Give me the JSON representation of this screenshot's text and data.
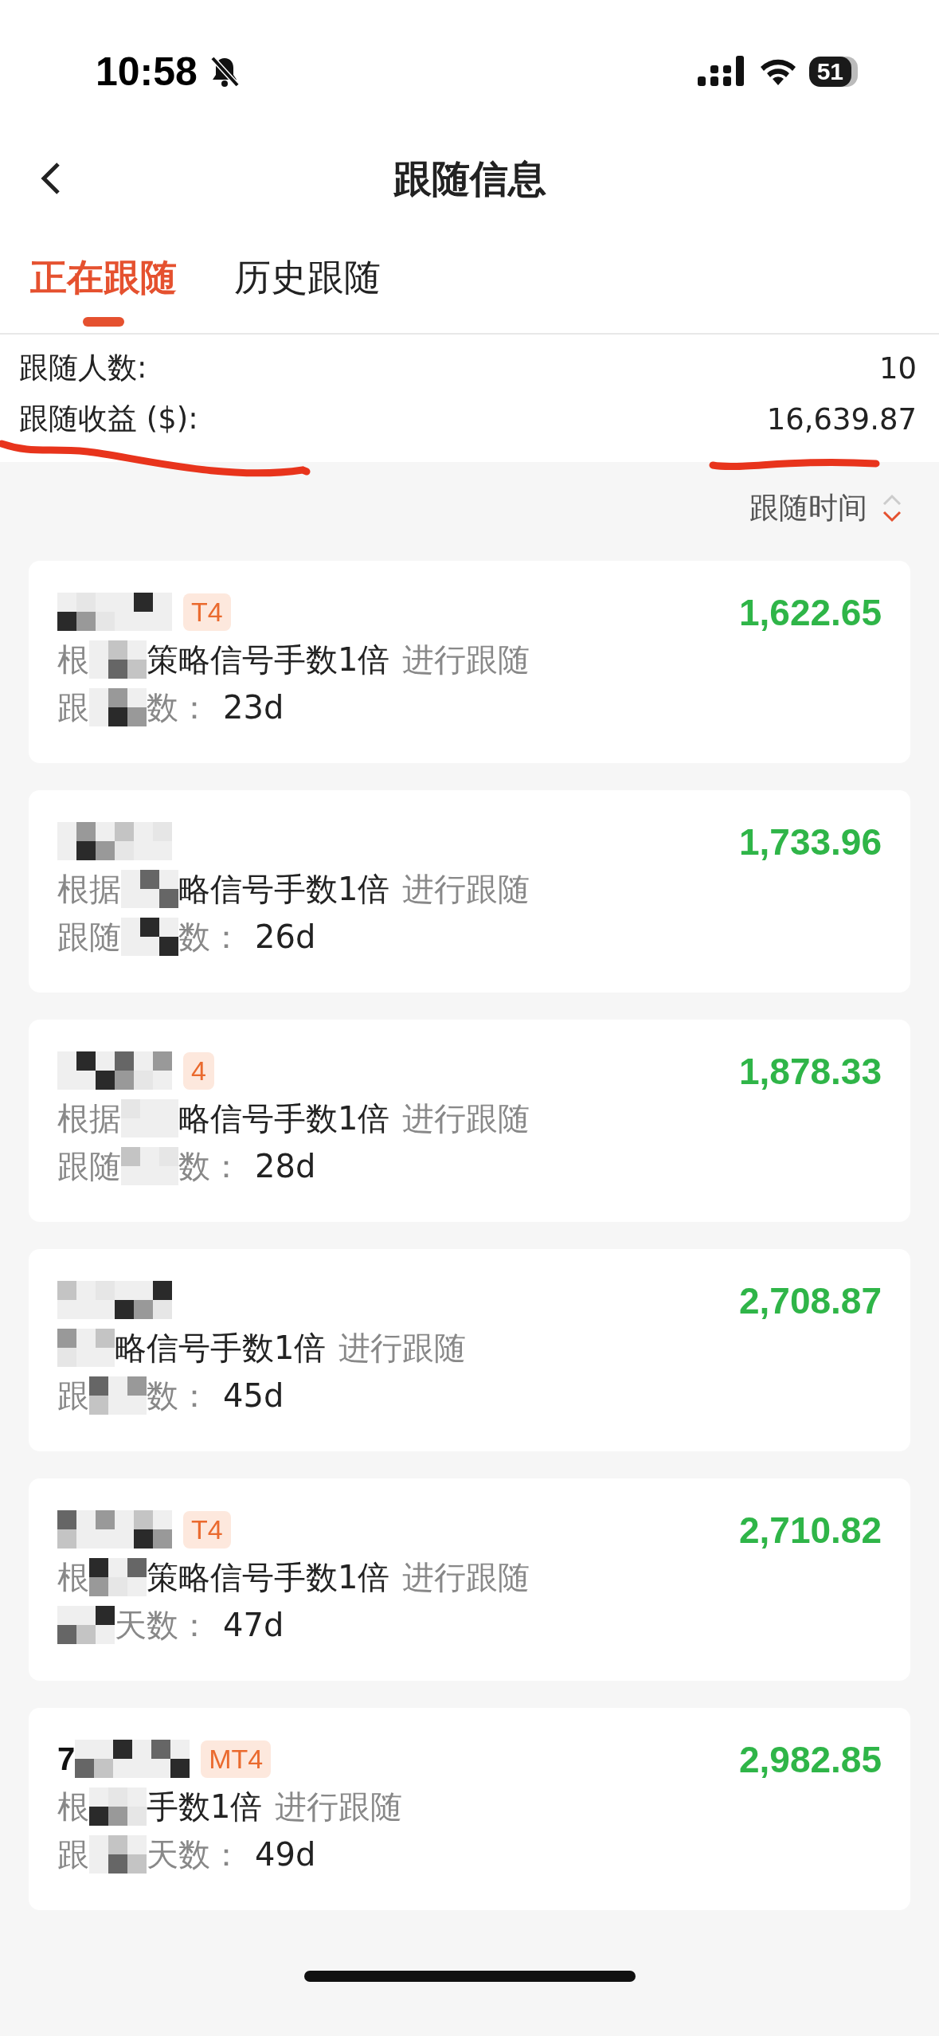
{
  "status_bar": {
    "time": "10:58",
    "battery": "51"
  },
  "header": {
    "title": "跟随信息"
  },
  "tabs": [
    {
      "label": "正在跟随",
      "selected": true
    },
    {
      "label": "历史跟随",
      "selected": false
    }
  ],
  "summary": [
    {
      "label": "跟随人数:",
      "value": "10"
    },
    {
      "label": "跟随收益 ($):",
      "value": "16,639.87"
    }
  ],
  "sort": {
    "label": "跟随时间"
  },
  "cards": [
    {
      "tag": "T4",
      "line1_prefix": "根",
      "line1_main": "策略信号手数1倍",
      "line1_suffix": "进行跟随",
      "line2_prefix": "跟",
      "line2_label": "数：",
      "line2_value": "23d",
      "amount": "1,622.65"
    },
    {
      "line1_prefix": "根据",
      "line1_main": "略信号手数1倍",
      "line1_suffix": "进行跟随",
      "line2_prefix": "跟随",
      "line2_label": "数：",
      "line2_value": "26d",
      "amount": "1,733.96"
    },
    {
      "tag": "4",
      "line1_prefix": "根据",
      "line1_main": "略信号手数1倍",
      "line1_suffix": "进行跟随",
      "line2_prefix": "跟随",
      "line2_label": "数：",
      "line2_value": "28d",
      "amount": "1,878.33"
    },
    {
      "line1_main": "略信号手数1倍",
      "line1_suffix": "进行跟随",
      "line2_prefix": "跟",
      "line2_label": "数：",
      "line2_value": "45d",
      "amount": "2,708.87"
    },
    {
      "tag": "T4",
      "line1_prefix": "根",
      "line1_main": "策略信号手数1倍",
      "line1_suffix": "进行跟随",
      "line2_label": "天数：",
      "line2_value": "47d",
      "amount": "2,710.82"
    },
    {
      "title": "7",
      "tag": "MT4",
      "line1_prefix": "根",
      "line1_main": "手数1倍",
      "line1_suffix": "进行跟随",
      "line2_prefix": "跟",
      "line2_label": "天数：",
      "line2_value": "49d",
      "amount": "2,982.85"
    }
  ]
}
